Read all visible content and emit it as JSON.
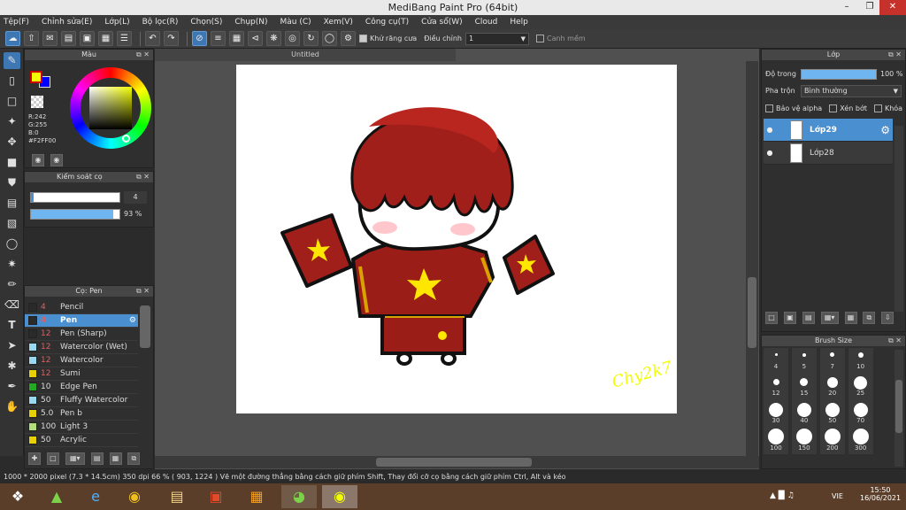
{
  "window": {
    "title": "MediBang Paint Pro (64bit)"
  },
  "menu": [
    "Tệp(F)",
    "Chỉnh sửa(E)",
    "Lớp(L)",
    "Bộ lọc(R)",
    "Chọn(S)",
    "Chụp(N)",
    "Màu (C)",
    "Xem(V)",
    "Công cụ(T)",
    "Cửa sổ(W)",
    "Cloud",
    "Help"
  ],
  "toolbar": {
    "antialias_label": "Khử răng cưa",
    "adjust_label": "Điều chỉnh",
    "adjust_value": "1",
    "smooth_label": "Canh mềm"
  },
  "color_panel": {
    "title": "Màu",
    "r": "R:242",
    "g": "G:255",
    "b": "B:0",
    "hex": "#F2FF00",
    "primary_color": "#F2FF00",
    "secondary_color": "#0000FF"
  },
  "brush_control": {
    "title": "Kiểm soát cọ",
    "size_value": "4",
    "opacity_value": "93 %"
  },
  "brush_panel": {
    "title": "Cọ: Pen",
    "items": [
      {
        "size": "4",
        "name": "Pencil",
        "color": "#2a2a2a"
      },
      {
        "size": "4",
        "name": "Pen",
        "color": "#2a2a2a"
      },
      {
        "size": "12",
        "name": "Pen (Sharp)",
        "color": "#2a2a2a"
      },
      {
        "size": "12",
        "name": "Watercolor (Wet)",
        "color": "#9ad8f0"
      },
      {
        "size": "12",
        "name": "Watercolor",
        "color": "#9ad8f0"
      },
      {
        "size": "12",
        "name": "Sumi",
        "color": "#e6d200"
      },
      {
        "size": "10",
        "name": "Edge Pen",
        "color": "#22aa22"
      },
      {
        "size": "50",
        "name": "Fluffy Watercolor",
        "color": "#9ad8f0"
      },
      {
        "size": "5.0",
        "name": "Pen b",
        "color": "#e6d200"
      },
      {
        "size": "100",
        "name": "Light 3",
        "color": "#b0e07a"
      },
      {
        "size": "50",
        "name": "Acrylic",
        "color": "#e6d200"
      }
    ]
  },
  "canvas": {
    "tab_title": "Untitled",
    "signature": "Chy2k7"
  },
  "layer_panel": {
    "title": "Lớp",
    "opacity_label": "Độ trong",
    "opacity_value": "100 %",
    "blend_label": "Pha trộn",
    "blend_value": "Bình thường",
    "protect_alpha": "Bảo vệ alpha",
    "clipping": "Xén bớt",
    "lock": "Khóa",
    "layers": [
      "Lớp29",
      "Lớp28"
    ]
  },
  "brush_size_panel": {
    "title": "Brush Size",
    "sizes": [
      "4",
      "5",
      "7",
      "10",
      "12",
      "15",
      "20",
      "25",
      "30",
      "40",
      "50",
      "70",
      "100",
      "150",
      "200",
      "300"
    ]
  },
  "status": {
    "text": "1000 * 2000 pixel   (7.3 * 14.5cm)   350 dpi   66 %   ( 903, 1224 )   Vẽ một đường thẳng bằng cách giữ phím Shift, Thay đổi cỡ cọ bằng cách giữ phím Ctrl, Alt và kéo"
  },
  "taskbar": {
    "lang": "VIE",
    "time": "15:50",
    "date": "16/06/2021"
  }
}
